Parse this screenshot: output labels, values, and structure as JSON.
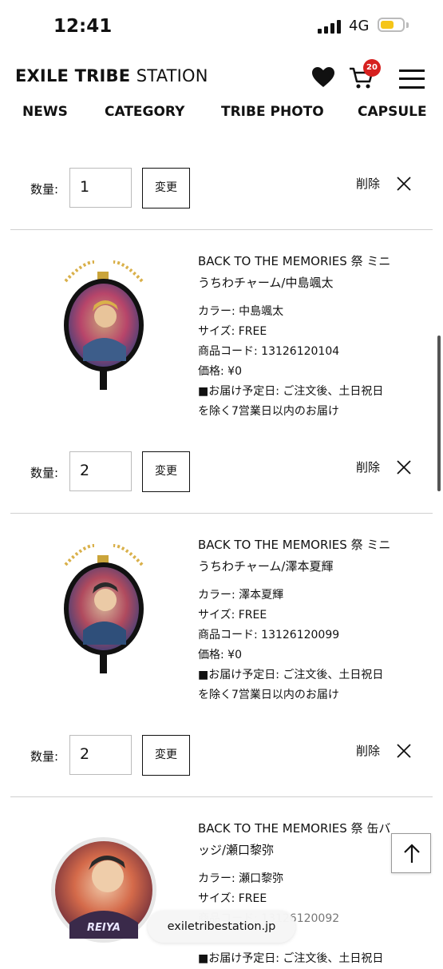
{
  "status_bar": {
    "time": "12:41",
    "network": "4G"
  },
  "header": {
    "logo_bold": "EXILE TRIBE",
    "logo_light": "STATION",
    "cart_count": "20"
  },
  "nav": [
    "NEWS",
    "CATEGORY",
    "TRIBE PHOTO",
    "CAPSULE"
  ],
  "cart": {
    "qty_label": "数量:",
    "change_label": "変更",
    "delete_label": "削除",
    "first_row_qty": "1",
    "items": [
      {
        "title_line1": "BACK TO THE MEMORIES 祭 ミニ",
        "title_line2": "うちわチャーム/中島颯太",
        "color": "カラー: 中島颯太",
        "size": "サイズ: FREE",
        "code": "商品コード: 13126120104",
        "price": "価格: ¥0",
        "delivery1": "■お届け予定日: ご注文後、土日祝日",
        "delivery2": "を除く7営業日以内のお届け",
        "qty": "2"
      },
      {
        "title_line1": "BACK TO THE MEMORIES 祭 ミニ",
        "title_line2": "うちわチャーム/澤本夏輝",
        "color": "カラー: 澤本夏輝",
        "size": "サイズ: FREE",
        "code": "商品コード: 13126120099",
        "price": "価格: ¥0",
        "delivery1": "■お届け予定日: ご注文後、土日祝日",
        "delivery2": "を除く7営業日以内のお届け",
        "qty": "2"
      },
      {
        "title_line1": "BACK TO THE MEMORIES 祭 缶バ",
        "title_line2": "ッジ/瀬口黎弥",
        "color": "カラー: 瀬口黎弥",
        "size": "サイズ: FREE",
        "code_partial": "商品コード: 13126120092",
        "delivery_partial": "■お届け予定日: ご注文後、土日祝日",
        "badge_text": "REIYA"
      }
    ]
  },
  "browser": {
    "url": "exiletribestation.jp"
  },
  "colors": {
    "badge": "#d6201f",
    "battery": "#f5c518"
  }
}
